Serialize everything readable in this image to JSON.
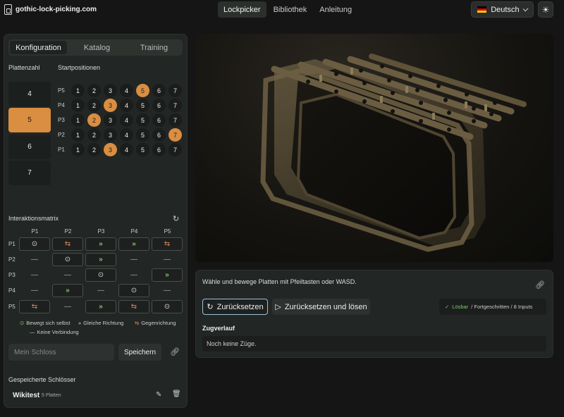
{
  "header": {
    "site_name": "gothic-lock-picking.com",
    "nav": [
      "Lockpicker",
      "Bibliothek",
      "Anleitung"
    ],
    "active_nav": 0,
    "language": "Deutsch",
    "flag_colors": [
      "#000000",
      "#dd0000",
      "#ffce00"
    ]
  },
  "left": {
    "tabs": [
      "Konfiguration",
      "Katalog",
      "Training"
    ],
    "active_tab": 0,
    "plate_count_label": "Plattenzahl",
    "start_positions_label": "Startpositionen",
    "plate_options": [
      "4",
      "5",
      "6",
      "7"
    ],
    "selected_plates": "5",
    "positions": [
      "1",
      "2",
      "3",
      "4",
      "5",
      "6",
      "7"
    ],
    "rows": [
      {
        "label": "P5",
        "active": 5
      },
      {
        "label": "P4",
        "active": 3
      },
      {
        "label": "P3",
        "active": 2
      },
      {
        "label": "P2",
        "active": 7
      },
      {
        "label": "P1",
        "active": 3
      }
    ],
    "matrix": {
      "title": "Interaktionsmatrix",
      "columns": [
        "P1",
        "P2",
        "P3",
        "P4",
        "P5"
      ],
      "rows": [
        {
          "label": "P1",
          "cells": [
            "self",
            "opp",
            "same",
            "same",
            "opp"
          ]
        },
        {
          "label": "P2",
          "cells": [
            "none",
            "self",
            "same",
            "none",
            "none"
          ]
        },
        {
          "label": "P3",
          "cells": [
            "none",
            "none",
            "self",
            "none",
            "same"
          ]
        },
        {
          "label": "P4",
          "cells": [
            "none",
            "same",
            "none",
            "self",
            "none"
          ]
        },
        {
          "label": "P5",
          "cells": [
            "opp",
            "none",
            "same",
            "opp",
            "self"
          ]
        }
      ],
      "symbols": {
        "self": "⊙",
        "same": "»",
        "opp": "⇆",
        "none": "—"
      }
    },
    "legend": {
      "self": "Bewegt sich selbst",
      "same": "Gleiche Richtung",
      "opp": "Gegenrichtung",
      "none": "Keine Verbindung"
    },
    "lock_name_placeholder": "Mein Schloss",
    "save_label": "Speichern",
    "saved_title": "Gespeicherte Schlösser",
    "saved_items": [
      {
        "name": "Wikitest",
        "meta": "5 Platten"
      }
    ]
  },
  "control": {
    "hint": "Wähle und bewege Platten mit Pfeiltasten oder WASD.",
    "reset_label": "Zurücksetzen",
    "reset_solve_label": "Zurücksetzen und lösen",
    "status_label": "Lösbar",
    "status_detail": "/ Fortgeschritten / 8 Inputs",
    "history_title": "Zugverlauf",
    "history_empty": "Noch keine Züge."
  }
}
